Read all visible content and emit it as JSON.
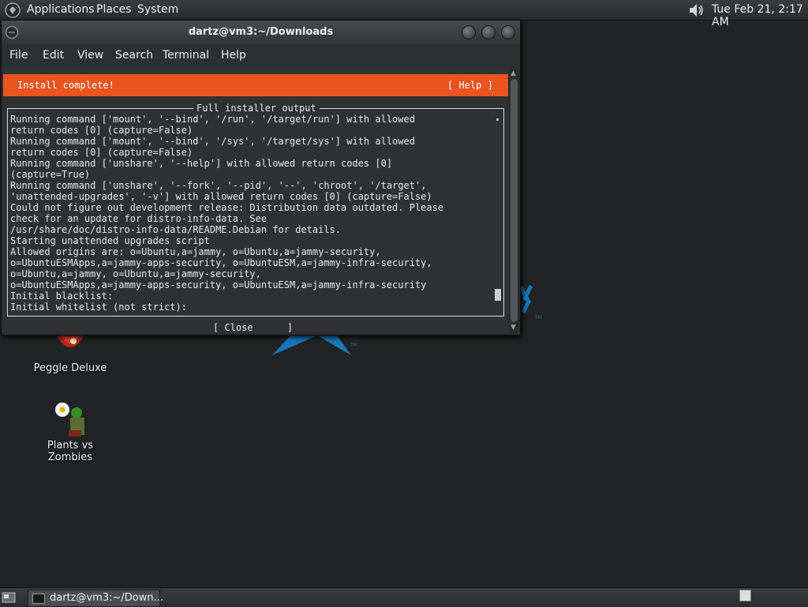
{
  "top_panel": {
    "menus": [
      "Applications",
      "Places",
      "System"
    ],
    "clock": "Tue Feb 21,  2:17 AM",
    "icons": [
      "gnome-foot-icon",
      "volume-icon"
    ]
  },
  "desktop": {
    "icons": [
      {
        "label": "Peggle Deluxe",
        "icon": "peggle-icon"
      },
      {
        "label": "Plants vs Zombies",
        "icon": "plants-vs-zombies-icon"
      }
    ]
  },
  "window": {
    "title": "dartz@vm3:~/Downloads",
    "menus": [
      "File",
      "Edit",
      "View",
      "Search",
      "Terminal",
      "Help"
    ],
    "status": "Install complete!",
    "help": "[ Help ]",
    "frame_title": "Full installer output",
    "lines": [
      "Running command ['mount', '--bind', '/run', '/target/run'] with allowed",
      "return codes [0] (capture=False)",
      "Running command ['mount', '--bind', '/sys', '/target/sys'] with allowed",
      "return codes [0] (capture=False)",
      "Running command ['unshare', '--help'] with allowed return codes [0]",
      "(capture=True)",
      "Running command ['unshare', '--fork', '--pid', '--', 'chroot', '/target',",
      "'unattended-upgrades', '-v'] with allowed return codes [0] (capture=False)",
      "Could not figure out development release: Distribution data outdated. Please",
      "check for an update for distro-info-data. See",
      "/usr/share/doc/distro-info-data/README.Debian for details.",
      "Starting unattended upgrades script",
      "Allowed origins are: o=Ubuntu,a=jammy, o=Ubuntu,a=jammy-security,",
      "o=UbuntuESMApps,a=jammy-apps-security, o=UbuntuESM,a=jammy-infra-security,",
      "o=Ubuntu,a=jammy, o=Ubuntu,a=jammy-security,",
      "o=UbuntuESMApps,a=jammy-apps-security, o=UbuntuESM,a=jammy-infra-security",
      "Initial blacklist:",
      "Initial whitelist (not strict):"
    ],
    "close": "[ Close      ]"
  },
  "bottom_panel": {
    "task": "dartz@vm3:~/Down..."
  },
  "colors": {
    "accent": "#e95420",
    "desktop": "#222324",
    "terminal_bg": "#2f3133"
  }
}
